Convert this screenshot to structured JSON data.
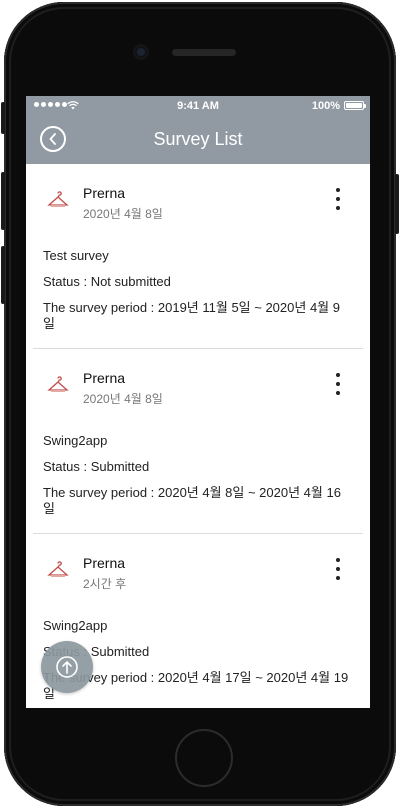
{
  "status_bar": {
    "time": "9:41 AM",
    "battery_percent": "100%",
    "icons": [
      "signal-dots-icon",
      "wifi-icon",
      "battery-icon"
    ]
  },
  "navbar": {
    "title": "Survey List",
    "back_icon": "chevron-left-icon"
  },
  "colors": {
    "header_bg": "#919aa3",
    "fab_bg": "#8c979f",
    "frame": "#0b0b0b"
  },
  "surveys": [
    {
      "author": "Prerna",
      "date": "2020년 4월 8일",
      "title": "Test survey",
      "status": "Status : Not submitted",
      "period": "The survey period : 2019년 11월 5일 ~ 2020년 4월 9일"
    },
    {
      "author": "Prerna",
      "date": "2020년 4월 8일",
      "title": "Swing2app",
      "status": "Status : Submitted",
      "period": "The survey period : 2020년 4월 8일 ~ 2020년 4월 16일"
    },
    {
      "author": "Prerna",
      "date": "2시간 후",
      "title": "Swing2app",
      "status": "Status : Submitted",
      "period": "The survey period : 2020년 4월 17일 ~ 2020년 4월 19일"
    }
  ],
  "fab": {
    "icon": "arrow-up-circle-icon"
  }
}
